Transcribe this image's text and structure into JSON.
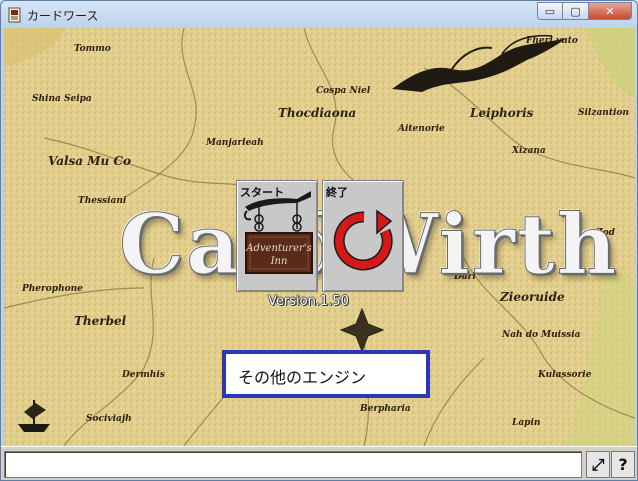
{
  "window": {
    "title": "カードワース",
    "minimize_glyph": "▭",
    "maximize_glyph": "▢",
    "close_glyph": "✕"
  },
  "map": {
    "places": [
      {
        "name": "Tommo"
      },
      {
        "name": "Shina Seipa"
      },
      {
        "name": "Valsa Mu Co"
      },
      {
        "name": "Thessiani"
      },
      {
        "name": "Cospa Niel"
      },
      {
        "name": "Thocdiaona"
      },
      {
        "name": "Aitenorie"
      },
      {
        "name": "Manjarleah"
      },
      {
        "name": "Leiphoris"
      },
      {
        "name": "Fherl vuto"
      },
      {
        "name": "Silzantion"
      },
      {
        "name": "Xizana"
      },
      {
        "name": "Pherophone"
      },
      {
        "name": "Therbel"
      },
      {
        "name": "Zieoruide"
      },
      {
        "name": "Nah do Muissia"
      },
      {
        "name": "Zod"
      },
      {
        "name": "Darl"
      },
      {
        "name": "Dermhis"
      },
      {
        "name": "Sociviajh"
      },
      {
        "name": "Berpharia"
      },
      {
        "name": "Kulassorie"
      },
      {
        "name": "Lapin"
      }
    ],
    "logo_text": "CardWirth",
    "version": "Version.1.50"
  },
  "cards": {
    "start_label": "スタート",
    "start_sign_line1": "Adventurer's",
    "start_sign_line2": "Inn",
    "exit_label": "終了"
  },
  "engine_button": {
    "label": "その他のエンジン"
  },
  "statusbar": {
    "message": "",
    "fullscreen_glyph": "⤢",
    "help_glyph": "?"
  },
  "colors": {
    "parchment": "#e2cd8a",
    "engine_border": "#2e36b8",
    "exit_icon": "#d81818"
  }
}
